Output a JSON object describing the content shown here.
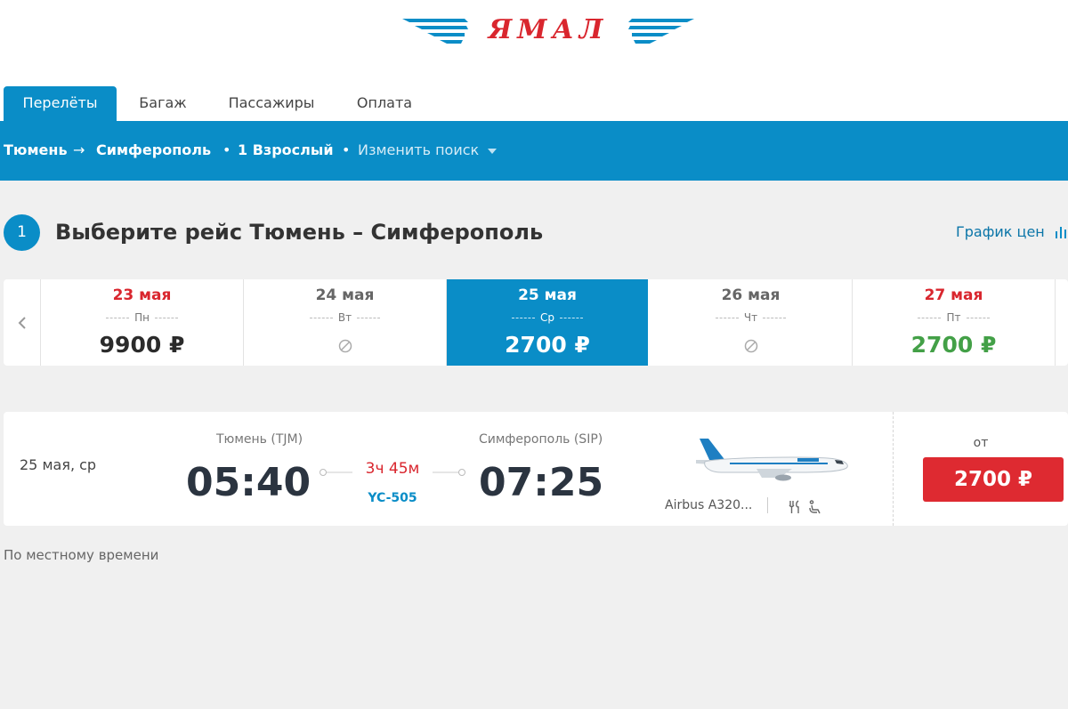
{
  "brand": {
    "logo_text": "ЯМАЛ",
    "primary_color": "#0a8dc7",
    "accent_color": "#d9262e"
  },
  "tabs": [
    {
      "label": "Перелёты",
      "active": true
    },
    {
      "label": "Багаж",
      "active": false
    },
    {
      "label": "Пассажиры",
      "active": false
    },
    {
      "label": "Оплата",
      "active": false
    }
  ],
  "search": {
    "origin": "Тюмень",
    "arrow": "→",
    "destination": "Симферополь",
    "passengers": "1 Взрослый",
    "separator": "•",
    "change_label": "Изменить поиск"
  },
  "step": {
    "number": "1",
    "title": "Выберите рейс Тюмень – Симферополь",
    "price_chart_label": "График цен"
  },
  "dates": [
    {
      "date": "23 мая",
      "dow": "Пн",
      "price": "9900 ₽",
      "weekend": true,
      "available": true,
      "selected": false,
      "lowest": false
    },
    {
      "date": "24 мая",
      "dow": "Вт",
      "price": "",
      "weekend": false,
      "available": false,
      "selected": false,
      "lowest": false
    },
    {
      "date": "25 мая",
      "dow": "Ср",
      "price": "2700 ₽",
      "weekend": false,
      "available": true,
      "selected": true,
      "lowest": true
    },
    {
      "date": "26 мая",
      "dow": "Чт",
      "price": "",
      "weekend": false,
      "available": false,
      "selected": false,
      "lowest": false
    },
    {
      "date": "27 мая",
      "dow": "Пт",
      "price": "2700 ₽",
      "weekend": true,
      "available": true,
      "selected": false,
      "lowest": true
    }
  ],
  "flight": {
    "date": "25 мая, ср",
    "departure_city": "Тюмень (TJM)",
    "departure_time": "05:40",
    "duration": "3ч 45м",
    "flight_number": "YC-505",
    "arrival_city": "Симферополь (SIP)",
    "arrival_time": "07:25",
    "aircraft": "Airbus A320...",
    "amenities": [
      "meal-icon",
      "seat-icon"
    ],
    "price_prefix": "от",
    "price": "2700 ₽"
  },
  "footnote": "По местному времени"
}
